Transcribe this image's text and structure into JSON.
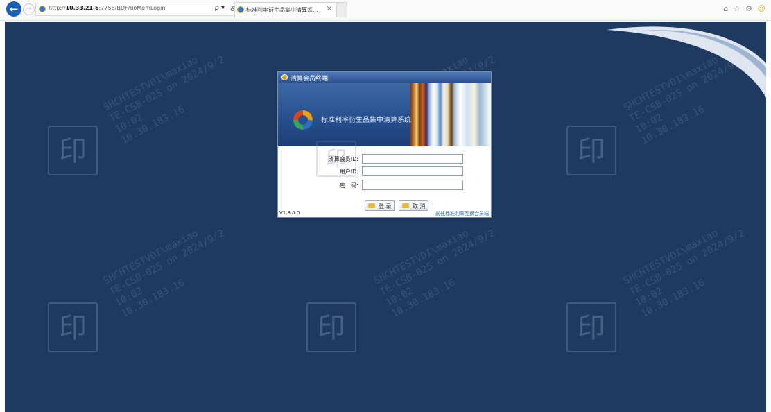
{
  "browser": {
    "address_prefix": "http://",
    "address_host": "10.33.21.6",
    "address_rest": ":7755/BDF/doMemLogin",
    "search_symbol": "ρ ▾",
    "refresh_symbol": "ᵹ",
    "tab_title": "标准利率衍生品集中清算系...",
    "tab_close": "×",
    "toolbar_icons": [
      "home-icon",
      "star-icon",
      "gear-icon",
      "smiley-icon"
    ],
    "toolbar_symbols": "⌂ ☆ ⚙",
    "smiley_symbol": "☺"
  },
  "login_window": {
    "title": "清算会员终端",
    "system_name": "标准利率衍生品集中清算系统",
    "fields": {
      "member_id_label": "清算会员ID:",
      "member_id_value": "",
      "user_id_label": "用户ID:",
      "user_id_value": "",
      "password_label": "密　码:",
      "password_value": ""
    },
    "login_button": "登 录",
    "cancel_button": "取 消",
    "version": "V1.8.0.0",
    "support_link": "前往标准利率互换会员端"
  },
  "watermark": {
    "text": "SHCHTESTVDI\\maxiao\nTE-CSB-025 on 2024/9/2\n10:02\n10.30.183.16",
    "seal_char": "印"
  },
  "colors": {
    "page_background": "#1f3a61",
    "title_bar": "#284f8d",
    "link": "#1f63b5"
  }
}
